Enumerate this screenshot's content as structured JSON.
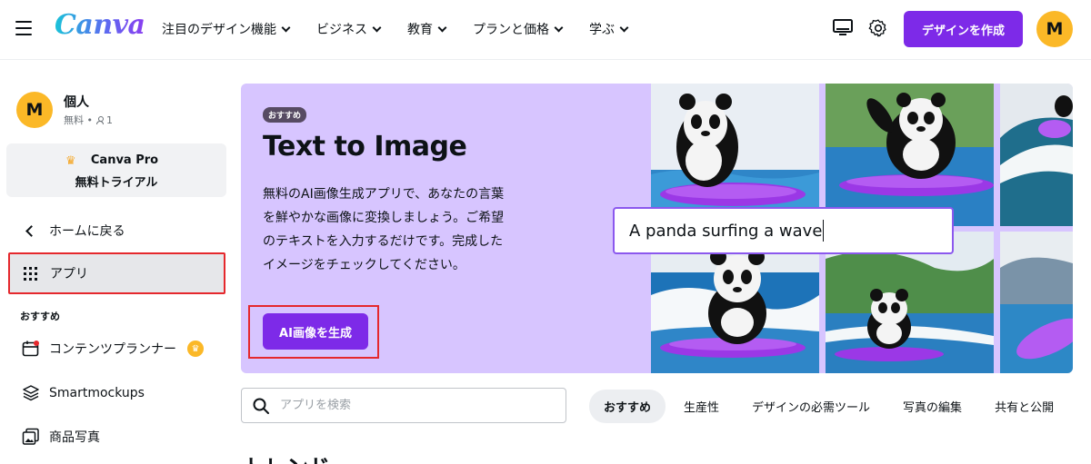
{
  "header": {
    "logo": "Canva",
    "nav": [
      "注目のデザイン機能",
      "ビジネス",
      "教育",
      "プランと価格",
      "学ぶ"
    ],
    "create_button": "デザインを作成",
    "avatar_initial": "M"
  },
  "sidebar": {
    "account": {
      "initial": "M",
      "name": "個人",
      "plan": "無料",
      "separator": "•",
      "members": "1"
    },
    "pro": {
      "line1": "Canva Pro",
      "line2": "無料トライアル"
    },
    "back_label": "ホームに戻る",
    "apps_label": "アプリ",
    "section_label": "おすすめ",
    "items": [
      {
        "label": "コンテンツプランナー",
        "icon": "calendar-icon",
        "pro": true
      },
      {
        "label": "Smartmockups",
        "icon": "layers-icon",
        "pro": false
      },
      {
        "label": "商品写真",
        "icon": "photos-icon",
        "pro": false
      }
    ]
  },
  "hero": {
    "badge": "おすすめ",
    "title": "Text to Image",
    "description": "無料のAI画像生成アプリで、あなたの言葉を鮮やかな画像に変換しましょう。ご希望のテキストを入力するだけです。完成したイメージをチェックしてください。",
    "button": "AI画像を生成",
    "prompt_text": "A panda surfing a wave"
  },
  "search": {
    "placeholder": "アプリを検索"
  },
  "tabs": [
    "おすすめ",
    "生産性",
    "デザインの必需ツール",
    "写真の編集",
    "共有と公開"
  ],
  "section_heading": "トレンド",
  "colors": {
    "brand_purple": "#7d2ae8",
    "hero_bg": "#d7c5ff",
    "highlight_red": "#e5282d",
    "avatar_yellow": "#fbb827"
  }
}
